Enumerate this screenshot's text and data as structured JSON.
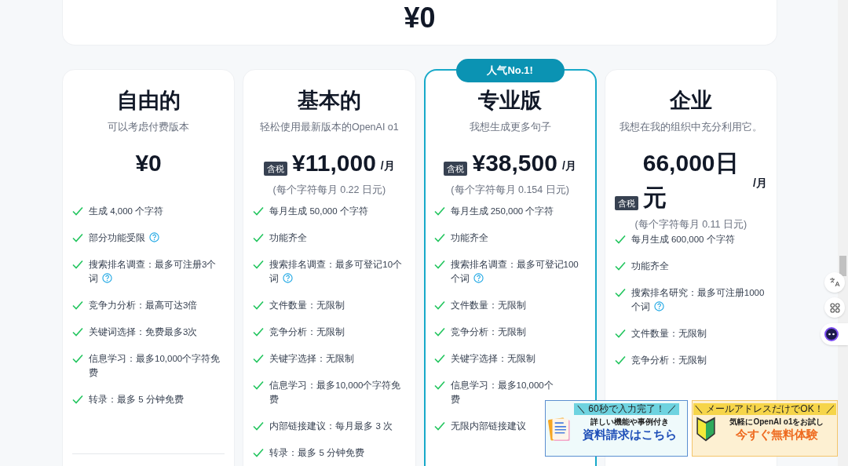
{
  "top_card": {
    "price": "¥0"
  },
  "plans": [
    {
      "title": "自由的",
      "subtitle": "可以考虑付费版本",
      "featured": false,
      "price": "¥0",
      "features": [
        {
          "text": "生成 4,000 个字符",
          "help": false
        },
        {
          "text": "部分功能受限",
          "help": true
        },
        {
          "text": "搜索排名调查：最多可注册3个词",
          "help": true
        },
        {
          "text": "竞争力分析：最高可达3倍",
          "help": false
        },
        {
          "text": "关键词选择：免费最多3次",
          "help": false
        },
        {
          "text": "信息学习：最多10,000个字符免费",
          "help": false
        },
        {
          "text": "转录：最多 5 分钟免费",
          "help": false
        }
      ],
      "divider": true
    },
    {
      "title": "基本的",
      "subtitle": "轻松使用最新版本的OpenAI o1",
      "featured": false,
      "tax_badge": "含税",
      "price": "¥11,000",
      "per": "/月",
      "note": "(每个字符每月 0.22 日元)",
      "features": [
        {
          "text": "每月生成 50,000 个字符",
          "help": false
        },
        {
          "text": "功能齐全",
          "help": false
        },
        {
          "text": "搜索排名调查：最多可登记10个词",
          "help": true
        },
        {
          "text": "文件数量：无限制",
          "help": false
        },
        {
          "text": "竞争分析：无限制",
          "help": false
        },
        {
          "text": "关键字选择：无限制",
          "help": false
        },
        {
          "text": "信息学习：最多10,000个字符免费",
          "help": false
        },
        {
          "text": "内部链接建议：每月最多 3 次",
          "help": false
        },
        {
          "text": "转录：最多 5 分钟免费",
          "help": false
        }
      ],
      "divider": false
    },
    {
      "title": "专业版",
      "subtitle": "我想生成更多句子",
      "featured": true,
      "badge": "人气No.1!",
      "tax_badge": "含税",
      "price": "¥38,500",
      "per": "/月",
      "note": "(每个字符每月 0.154 日元)",
      "features": [
        {
          "text": "每月生成 250,000 个字符",
          "help": false
        },
        {
          "text": "功能齐全",
          "help": false
        },
        {
          "text": "搜索排名调查：最多可登记100个词",
          "help": true
        },
        {
          "text": "文件数量：无限制",
          "help": false
        },
        {
          "text": "竞争分析：无限制",
          "help": false
        },
        {
          "text": "关键字选择：无限制",
          "help": false
        },
        {
          "text": "信息学习：最多10,000个",
          "continuation": "费",
          "help": false
        },
        {
          "text": "无限内部链接建议",
          "help": false
        }
      ],
      "divider": false
    },
    {
      "title": "企业",
      "subtitle": "我想在我的组织中充分利用它。",
      "featured": false,
      "tax_badge": "含税",
      "price": "66,000日元",
      "per": "/月",
      "note": "(每个字符每月 0.11 日元)",
      "features": [
        {
          "text": "每月生成 600,000 个字符",
          "help": false
        },
        {
          "text": "功能齐全",
          "help": false
        },
        {
          "text": "搜索排名研究：最多可注册1000个词",
          "help": true
        },
        {
          "text": "文件数量：无限制",
          "help": false
        },
        {
          "text": "竞争分析：无限制",
          "help": false
        }
      ],
      "divider": false
    }
  ],
  "ads": [
    {
      "kind": "document",
      "tagline": "＼ 60秒で入力完了！ ／",
      "line": "詳しい機能や事例付き",
      "cta": "資料請求はこちら"
    },
    {
      "kind": "beginner",
      "tagline": "＼ メールアドレスだけでOK！ ／",
      "line": "気軽にOpenAI o1をお試し",
      "cta": "今すぐ無料体験"
    }
  ]
}
